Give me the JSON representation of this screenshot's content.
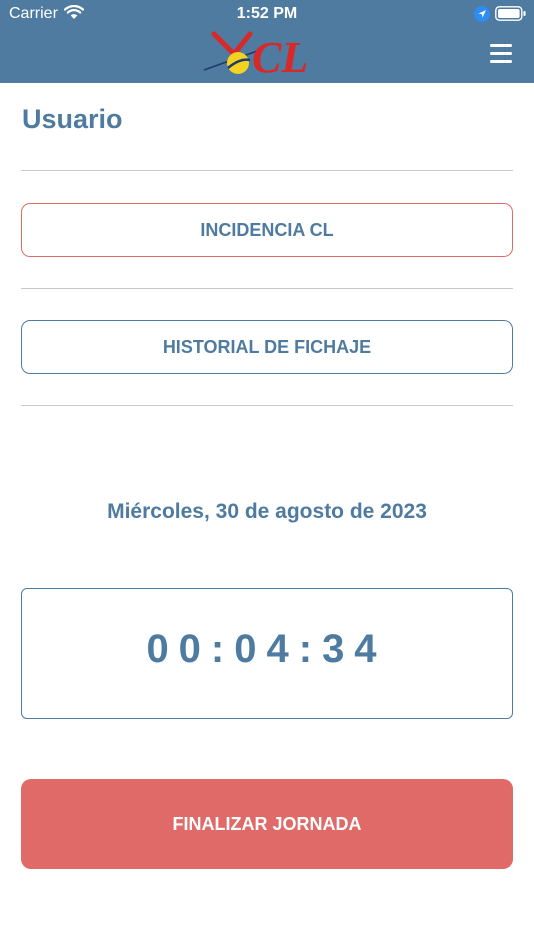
{
  "status_bar": {
    "carrier": "Carrier",
    "time": "1:52 PM"
  },
  "header": {
    "logo_text": "CL",
    "menu_icon": "hamburger-menu-icon"
  },
  "page": {
    "title": "Usuario"
  },
  "buttons": {
    "incidencia": "INCIDENCIA CL",
    "historial": "HISTORIAL DE FICHAJE",
    "finalizar": "FINALIZAR JORNADA"
  },
  "date": "Miércoles, 30 de agosto de 2023",
  "timer": "00:04:34",
  "colors": {
    "primary": "#4e7b9f",
    "accent_red": "#e06a67",
    "divider": "#c9c9c9",
    "logo_red": "#d92828",
    "logo_yellow": "#f4d21f"
  }
}
